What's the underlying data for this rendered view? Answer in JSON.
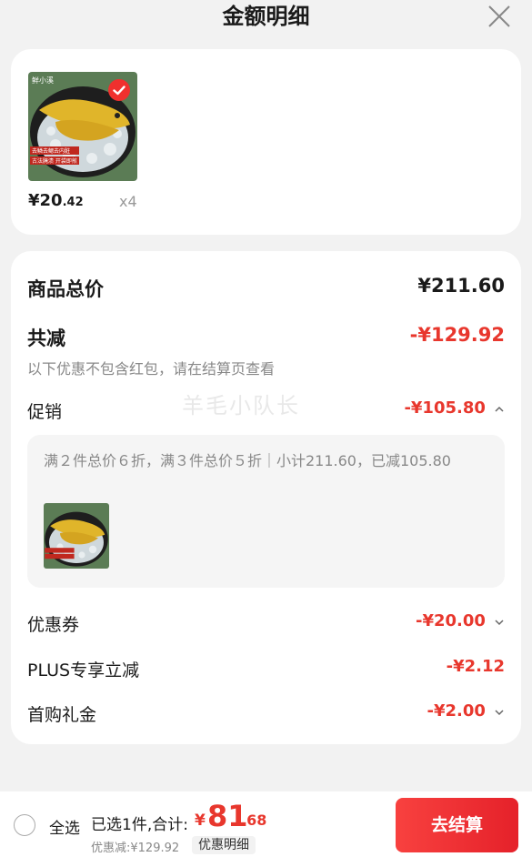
{
  "header": {
    "title": "金额明细"
  },
  "product": {
    "price_yen": "¥",
    "price_int": "20",
    "price_dec": ".42",
    "quantity": "x4",
    "image_text_line1": "去鳞去鳃去内脏",
    "image_text_line2": "古法腌渍 开袋即煎",
    "image_brand": "鲜小溪"
  },
  "summary": {
    "total_label": "商品总价",
    "total_value": "¥211.60",
    "reduce_label": "共减",
    "reduce_value": "-¥129.92",
    "reduce_note": "以下优惠不包含红包，请在结算页查看",
    "promo_label": "促销",
    "promo_value": "-¥105.80",
    "promo_detail": "满２件总价６折，满３件总价５折｜小计211.60，已减105.80",
    "watermark": "羊毛小队长",
    "coupon_label": "优惠券",
    "coupon_value": "-¥20.00",
    "plus_label": "PLUS专享立减",
    "plus_value": "-¥2.12",
    "firstbuy_label": "首购礼金",
    "firstbuy_value": "-¥2.00"
  },
  "bottom": {
    "select_all": "全选",
    "selected_text": "已选1件,合计:",
    "total_yen": "¥",
    "total_int": "81",
    "total_dec": ".68",
    "discount_text": "优惠减:¥129.92",
    "detail_tag": "优惠明细",
    "checkout_label": "去结算"
  },
  "colors": {
    "accent_red": "#e8372d",
    "checkout_red": "#f23030"
  }
}
